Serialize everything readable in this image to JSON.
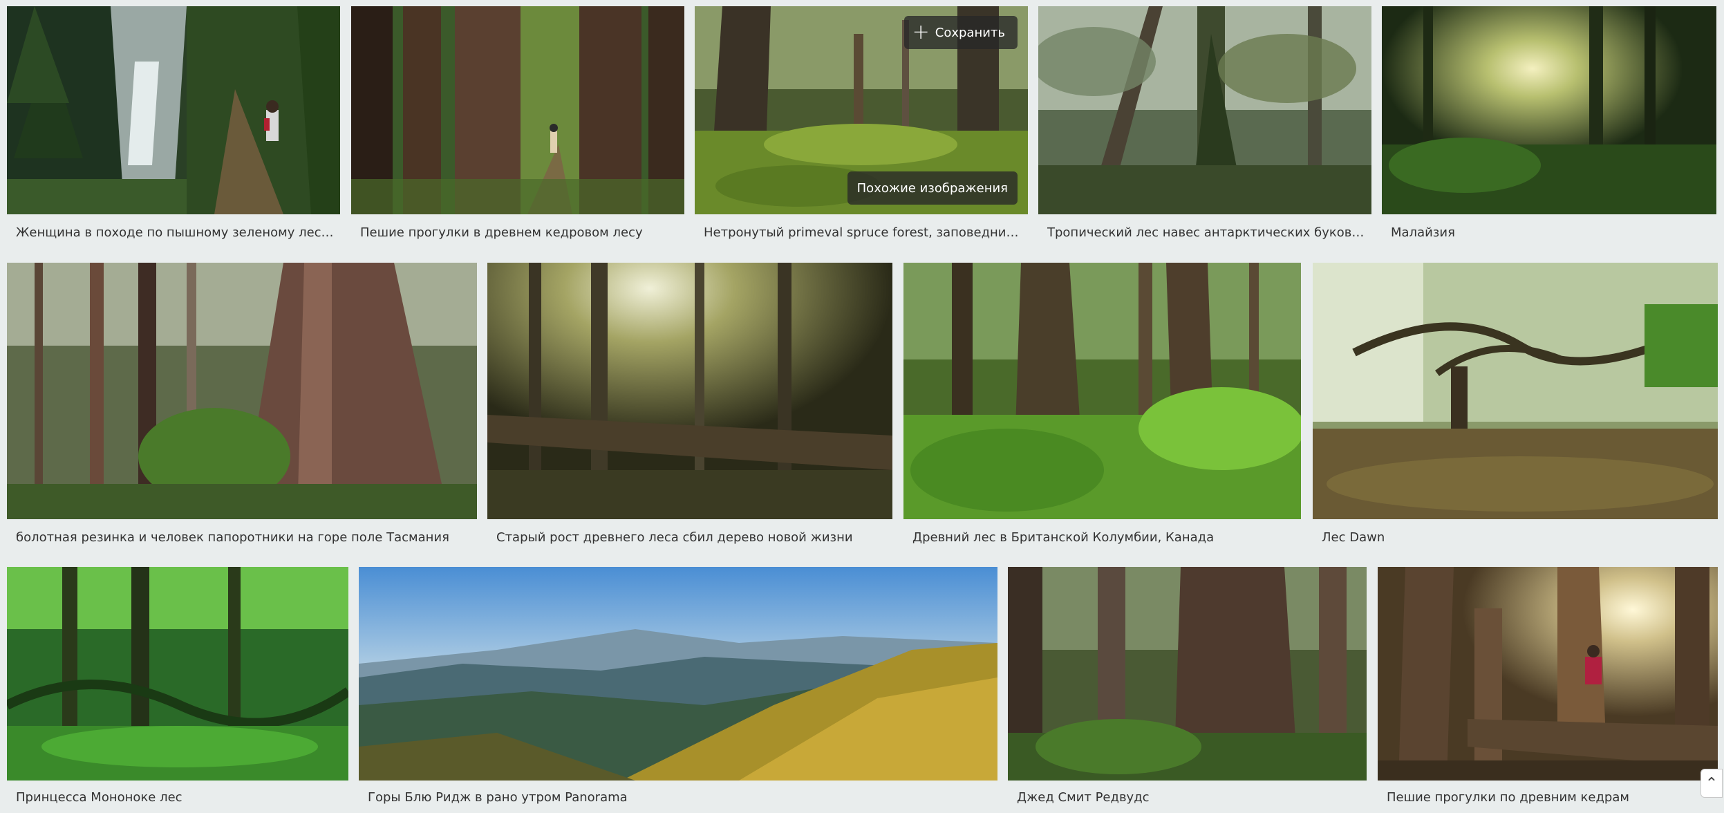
{
  "overlay": {
    "save_label": "Сохранить",
    "similar_label": "Похожие изображения"
  },
  "rows": [
    {
      "tiles": [
        {
          "caption": "Женщина в походе по пышному зеленому лесу возл...",
          "palette": [
            "#2f4a2c",
            "#6f8f5a",
            "#1b2b1a"
          ],
          "subject": "waterfall trail with hiker"
        },
        {
          "caption": "Пешие прогулки в древнем кедровом лесу",
          "palette": [
            "#3a2e22",
            "#5f7a3a",
            "#1f1a14"
          ],
          "subject": "cedar trunks with hiker"
        },
        {
          "caption": "Нетронутый primeval spruce forest, заповедник в ...",
          "palette": [
            "#3e4a2c",
            "#8a9a4a",
            "#232a18"
          ],
          "subject": "moss forest"
        },
        {
          "caption": "Тропический лес навес антарктических буковых дер...",
          "palette": [
            "#4a5a40",
            "#a6b49a",
            "#263224"
          ],
          "subject": "misty rainforest"
        },
        {
          "caption": "Малайзия",
          "palette": [
            "#2a3a1e",
            "#b8c47a",
            "#16200f"
          ],
          "subject": "sunlit jungle"
        }
      ]
    },
    {
      "tiles": [
        {
          "caption": "болотная резинка и человек папоротники на горе поле Тасмания",
          "palette": [
            "#3d3a2e",
            "#7c8a5c",
            "#5a3a2a"
          ],
          "subject": "swamp gum with ferns"
        },
        {
          "caption": "Старый рост древнего леса сбил дерево новой жизни",
          "palette": [
            "#4a4a2a",
            "#c8c890",
            "#2a2a18"
          ],
          "subject": "fallen log in sunlit forest"
        },
        {
          "caption": "Древний лес в Британской Колумбии, Канада",
          "palette": [
            "#3a4a22",
            "#7fae3a",
            "#2a2418"
          ],
          "subject": "giant cedars with green undergrowth"
        },
        {
          "caption": "Лес Dawn",
          "palette": [
            "#5a6a3a",
            "#d4dcc0",
            "#6a4a2a"
          ],
          "subject": "oak trees at dawn"
        }
      ]
    },
    {
      "tiles": [
        {
          "caption": "Принцесса Мононоке лес",
          "palette": [
            "#1f5a22",
            "#4ea83a",
            "#0f2a12"
          ],
          "subject": "moss covered forest"
        },
        {
          "caption": "Горы Блю Ридж в рано утром Panorama",
          "palette": [
            "#6fa4d8",
            "#c8a840",
            "#3a5a4a"
          ],
          "subject": "blue ridge mountains panorama"
        },
        {
          "caption": "Джед Смит Редвудс",
          "palette": [
            "#4a3a2e",
            "#6a8a4a",
            "#2a221a"
          ],
          "subject": "redwood trunks"
        },
        {
          "caption": "Пешие прогулки по древним кедрам",
          "palette": [
            "#5a4a30",
            "#d8c890",
            "#2e2418"
          ],
          "subject": "hiker on fallen log"
        }
      ]
    }
  ],
  "scroll_top_icon": "chevron-up-icon"
}
